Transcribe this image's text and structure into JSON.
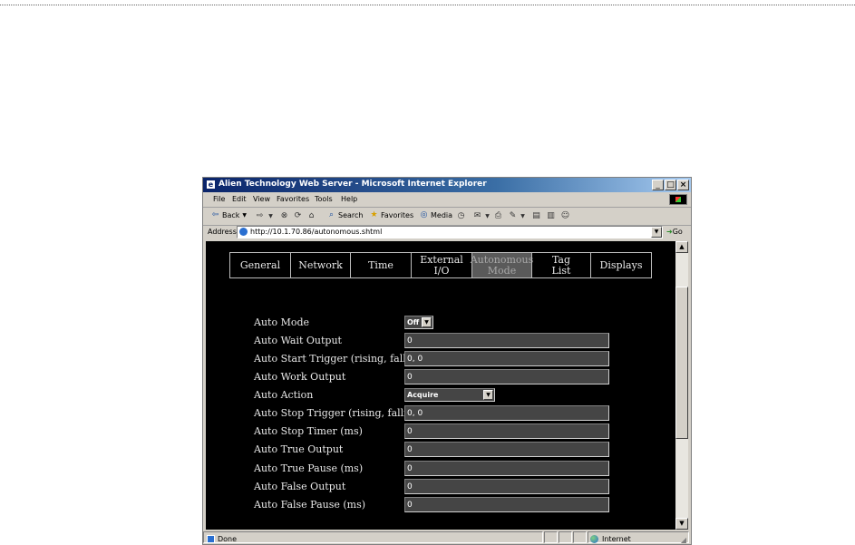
{
  "window": {
    "title": "Alien Technology Web Server - Microsoft Internet Explorer"
  },
  "menu": [
    "File",
    "Edit",
    "View",
    "Favorites",
    "Tools",
    "Help"
  ],
  "toolbar": {
    "back": "Back",
    "search": "Search",
    "favorites": "Favorites",
    "media": "Media"
  },
  "address": {
    "label": "Address",
    "url": "http://10.1.70.86/autonomous.shtml",
    "go": "Go"
  },
  "nav": [
    {
      "label": "General"
    },
    {
      "label": "Network"
    },
    {
      "label": "Time"
    },
    {
      "label": "External\nI/O"
    },
    {
      "label": "Autonomous\nMode"
    },
    {
      "label": "Tag\nList"
    },
    {
      "label": "Displays"
    }
  ],
  "form": {
    "auto_mode": {
      "label": "Auto Mode",
      "value": "Off"
    },
    "auto_wait_output": {
      "label": "Auto Wait Output",
      "value": "0"
    },
    "auto_start_trigger": {
      "label": "Auto Start Trigger (rising, falling)",
      "value": "0, 0"
    },
    "auto_work_output": {
      "label": "Auto Work Output",
      "value": "0"
    },
    "auto_action": {
      "label": "Auto Action",
      "value": "Acquire"
    },
    "auto_stop_trigger": {
      "label": "Auto Stop Trigger (rising, falling)",
      "value": "0, 0"
    },
    "auto_stop_timer": {
      "label": "Auto Stop Timer (ms)",
      "value": "0"
    },
    "auto_true_output": {
      "label": "Auto True Output",
      "value": "0"
    },
    "auto_true_pause": {
      "label": "Auto True Pause (ms)",
      "value": "0"
    },
    "auto_false_output": {
      "label": "Auto False Output",
      "value": "0"
    },
    "auto_false_pause": {
      "label": "Auto False Pause (ms)",
      "value": "0"
    }
  },
  "status": {
    "text": "Done",
    "zone": "Internet"
  },
  "icons": [
    "ie-app-icon",
    "minimize-icon",
    "maximize-icon",
    "close-icon",
    "back-arrow-icon",
    "forward-arrow-icon",
    "stop-icon",
    "refresh-icon",
    "home-icon",
    "search-icon",
    "favorites-icon",
    "media-icon",
    "history-icon",
    "mail-icon",
    "print-icon",
    "edit-icon",
    "discuss-icon",
    "messenger-icon",
    "page-icon",
    "go-arrow-icon",
    "globe-icon"
  ]
}
